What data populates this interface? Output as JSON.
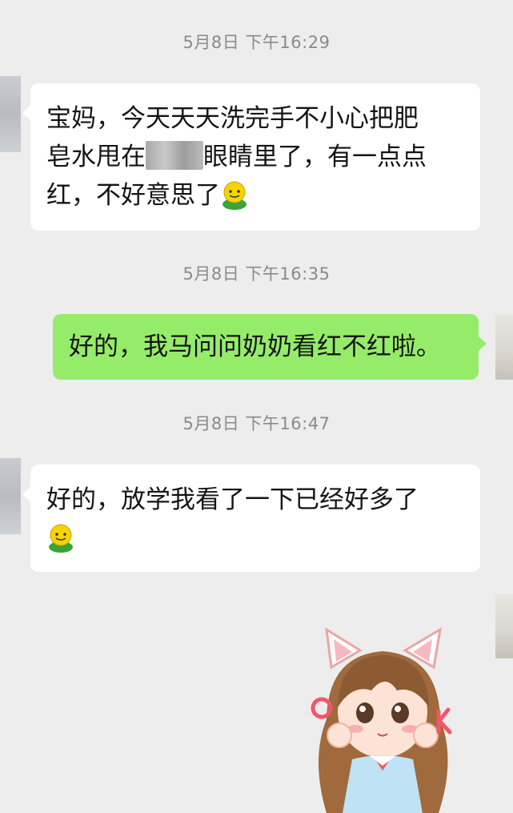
{
  "messages": [
    {
      "time": "5月8日 下午16:29",
      "line1": "宝妈，今天天天洗完手不小心把肥",
      "line2a": "皂水甩在",
      "line2b": "眼睛里了，有一点点",
      "line3": "红，不好意思了",
      "emoji": "smile-emoji"
    },
    {
      "time": "5月8日 下午16:35",
      "text": "好的，我马问问奶奶看红不红啦。"
    },
    {
      "time": "5月8日 下午16:47",
      "line1": "好的，放学我看了一下已经好多了",
      "emoji": "smile-emoji"
    }
  ],
  "sticker": {
    "name": "cute-girl-ok-sticker"
  },
  "colors": {
    "background": "#ededed",
    "incoming_bubble": "#ffffff",
    "outgoing_bubble": "#95ec69",
    "timestamp": "#8a8a8a"
  }
}
